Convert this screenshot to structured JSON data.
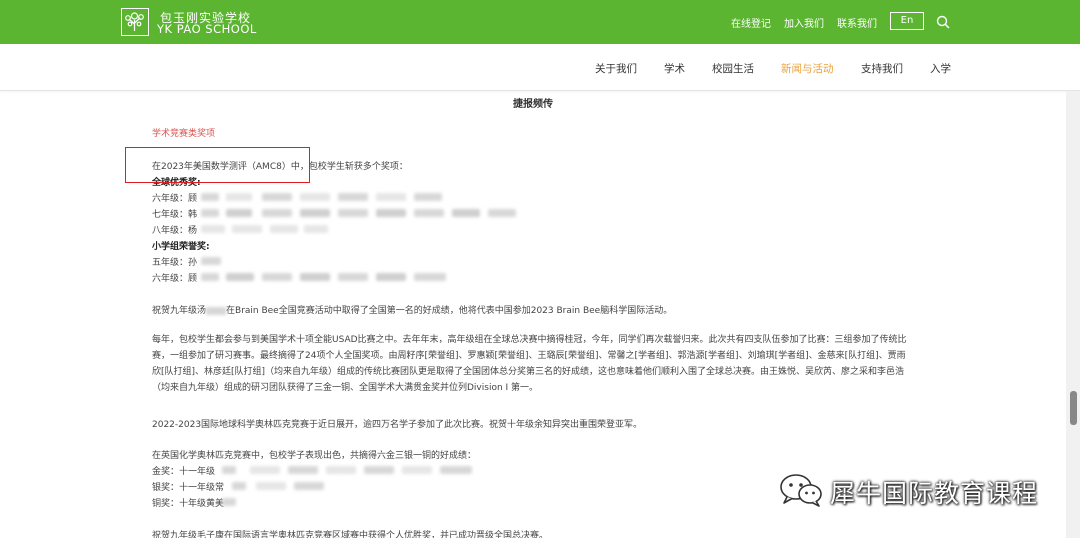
{
  "header": {
    "logo_cn": "包玉刚实验学校",
    "logo_en": "YK PAO SCHOOL",
    "links": [
      "在线登记",
      "加入我们",
      "联系我们"
    ],
    "lang_button": "En",
    "brand_color": "#5cb531"
  },
  "nav": {
    "items": [
      "关于我们",
      "学术",
      "校园生活",
      "新闻与活动",
      "支持我们",
      "入学"
    ],
    "active_index": 3,
    "active_color": "#e8a13c"
  },
  "article": {
    "heading": "捷报频传",
    "section_title": "学术竞赛类奖项",
    "amc_intro": "在2023年美国数学测评（AMC8）中，包校学生斩获多个奖项：",
    "global_title": "全球优秀奖:",
    "global_lines": [
      "六年级：顾",
      "七年级：韩",
      "八年级：杨"
    ],
    "primary_title": "小学组荣誉奖:",
    "primary_lines": [
      "五年级：孙",
      "六年级：顾"
    ],
    "brainbee_pre": "祝贺九年级汤",
    "brainbee_post": "在Brain Bee全国竞赛活动中取得了全国第一名的好成绩，他将代表中国参加2023 Brain Bee脑科学国际活动。",
    "usad": "每年，包校学生都会参与到美国学术十项全能USAD比赛之中。去年年末，高年级组在全球总决赛中摘得桂冠，今年，同学们再次载誉归来。此次共有四支队伍参加了比赛：三组参加了传统比赛，一组参加了研习赛事。最终摘得了24项个人全国奖项。由周籽序[荣誉组]、罗惠颖[荣誉组]、王璐辰[荣誉组]、常馨之[学者组]、郭浩源[学者组]、刘瑜琪[学者组]、金慈来[队打组]、贾雨欣[队打组]、林彦廷[队打组]（均来自九年级）组成的传统比赛团队更是取得了全国团体总分奖第三名的好成绩，这也意味着他们顺利入围了全球总决赛。由王姝悦、吴欣芮、廖之采和李邑浩（均来自九年级）组成的研习团队获得了三金一铜、全国学术大满贯金奖并位列Division I 第一。",
    "earth": "2022-2023国际地球科学奥林匹克竞赛于近日展开，逾四万名学子参加了此次比赛。祝贺十年级余知异突出重围荣登亚军。",
    "chem_intro": "在英国化学奥林匹克竞赛中，包校学子表现出色，共摘得六金三银一铜的好成绩：",
    "chem_lines": [
      "金奖：十一年级",
      "银奖：十一年级常",
      "铜奖：十年级黄美"
    ],
    "last_line": "祝贺九年级毛子康在国际语言学奥林匹克竞赛区域赛中获得个人优胜奖，并已成功晋级全国总决赛。"
  },
  "watermark": {
    "text": "犀牛国际教育课程",
    "icon": "wechat-icon"
  }
}
